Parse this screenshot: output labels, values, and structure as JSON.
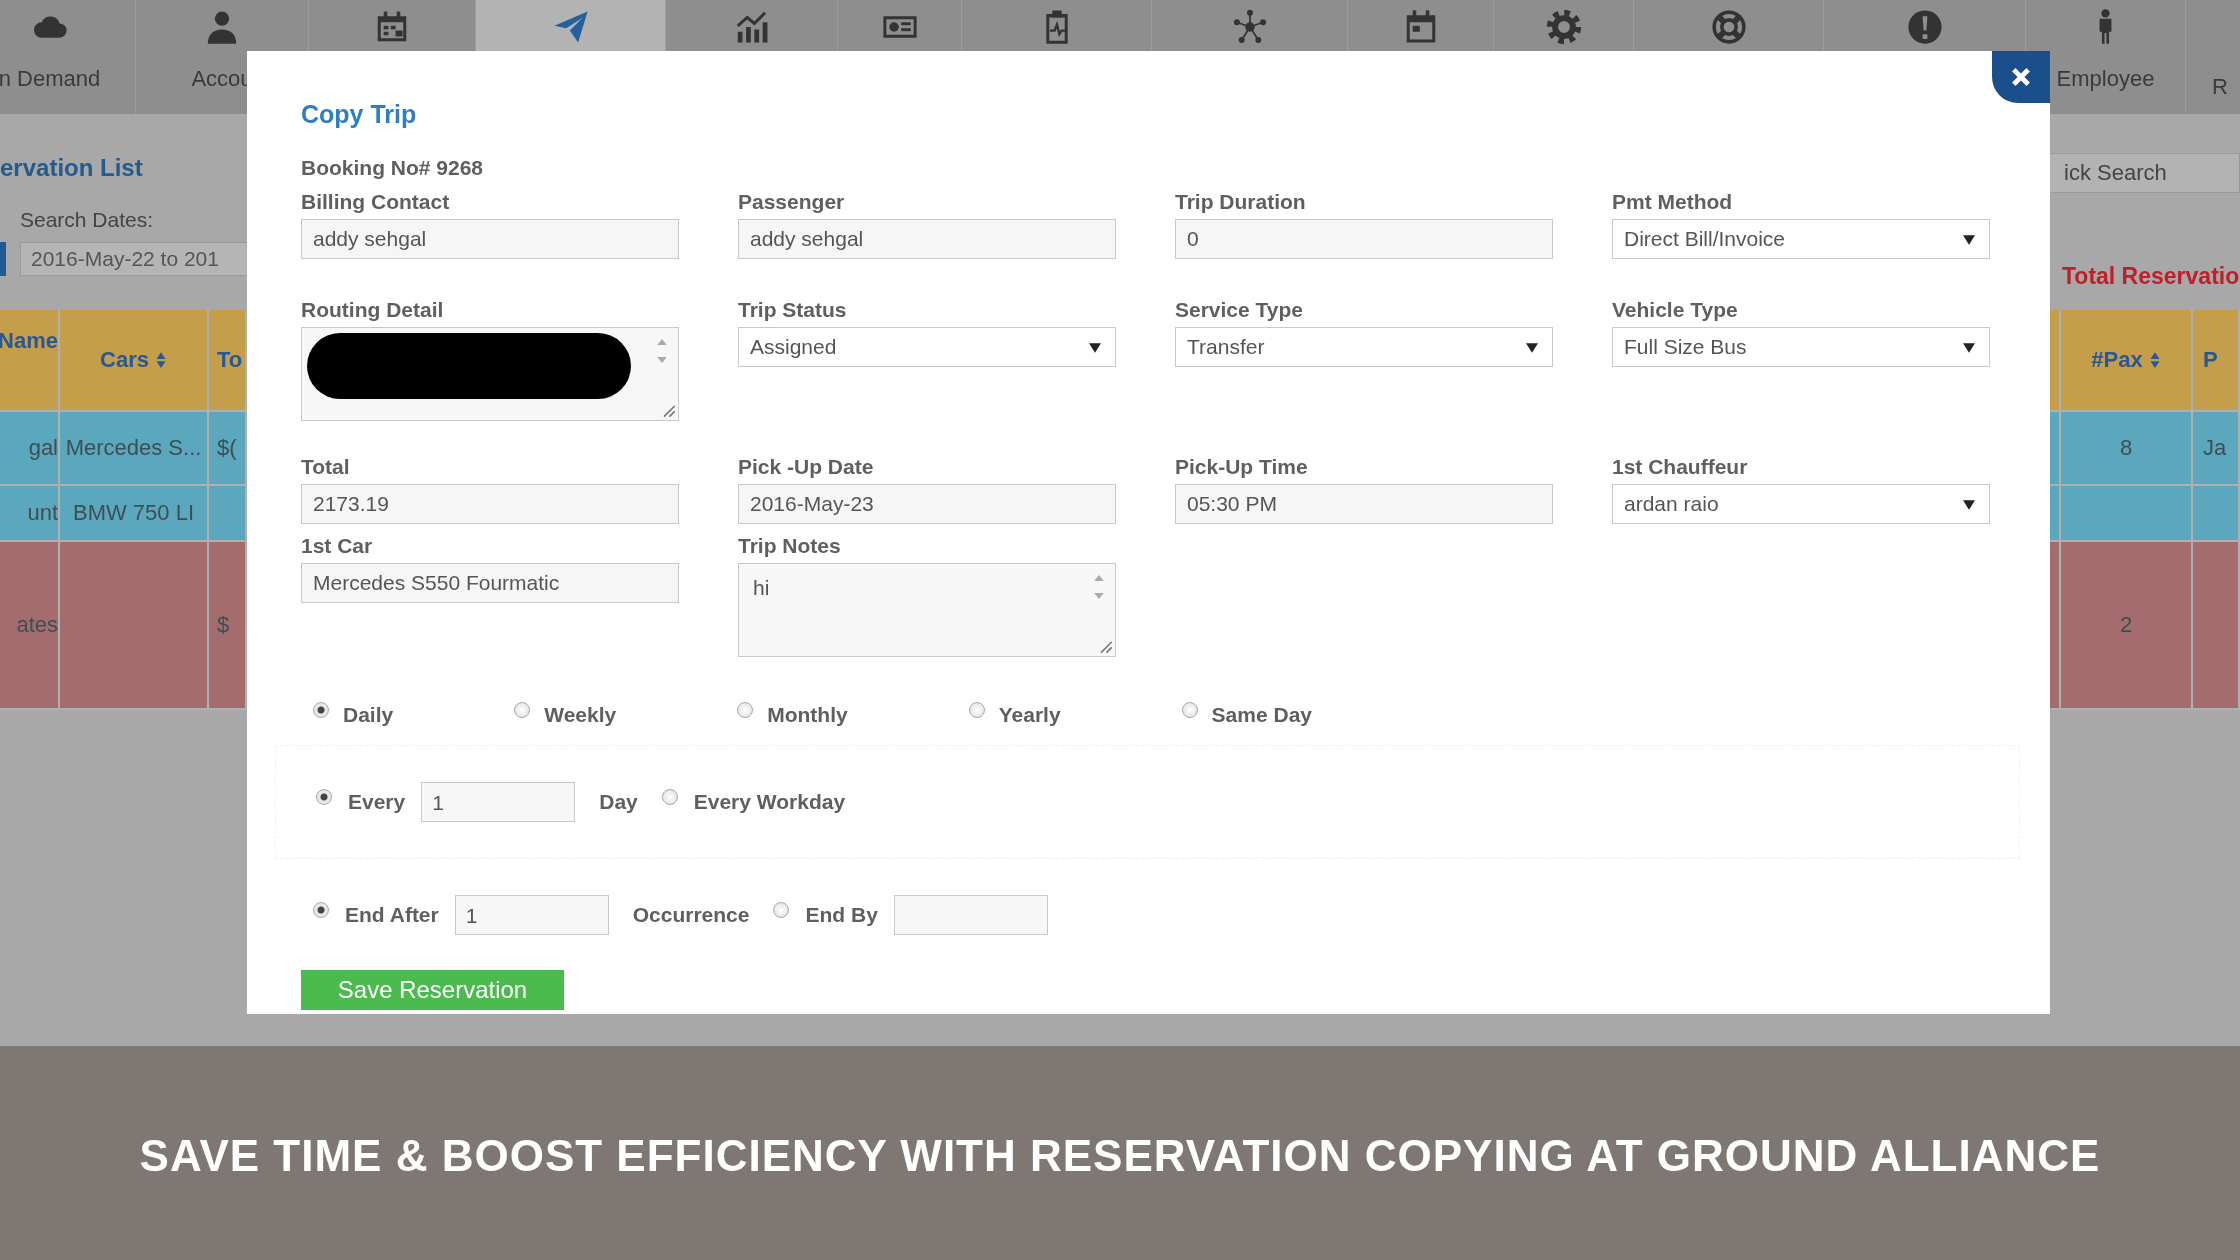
{
  "nav": [
    {
      "label": "n Demand",
      "selected": false
    },
    {
      "label": "Accou",
      "selected": false
    },
    {
      "selected": false
    },
    {
      "selected": true
    },
    {
      "selected": false
    },
    {
      "selected": false
    },
    {
      "selected": false
    },
    {
      "selected": false
    },
    {
      "selected": false
    },
    {
      "selected": false
    },
    {
      "selected": false
    },
    {
      "selected": false
    },
    {
      "label": "Employee",
      "selected": false
    },
    {
      "label": "R",
      "selected": false
    }
  ],
  "background": {
    "list_title": "ervation List",
    "search_label": "Search Dates:",
    "search_value": "2016-May-22 to 201",
    "quick_search_placeholder": "ick Search",
    "total_label": "Total Reservatio",
    "left_columns": [
      {
        "label": "Name",
        "sortable": false
      },
      {
        "label": "Cars",
        "sortable": true
      },
      {
        "label": "To"
      }
    ],
    "right_columns": [
      {
        "label": "#Pax",
        "sortable": true
      },
      {
        "label": "P"
      }
    ],
    "rows": [
      {
        "color": "#5ba8be",
        "left_cells": [
          "gal",
          "Mercedes S...",
          "$("
        ],
        "right_cells": [
          "8",
          "Ja"
        ]
      },
      {
        "color": "#5ba8be",
        "left_cells": [
          "unt",
          "BMW 750 LI",
          null
        ],
        "right_cells": [
          null,
          null
        ]
      },
      {
        "color": "#a46c6c",
        "left_cells": [
          "ates",
          null,
          "$"
        ],
        "right_cells": [
          "2",
          null
        ]
      }
    ]
  },
  "modal": {
    "title": "Copy Trip",
    "booking": "Booking No# 9268",
    "field_rows": [
      [
        {
          "label": "Billing Contact",
          "kind": "text",
          "value": "addy sehgal"
        },
        {
          "label": "Passenger",
          "kind": "text",
          "value": "addy sehgal"
        },
        {
          "label": "Trip Duration",
          "kind": "text",
          "value": "0"
        },
        {
          "label": "Pmt Method",
          "kind": "select",
          "value": "Direct Bill/Invoice"
        }
      ],
      [
        {
          "label": "Routing Detail",
          "kind": "textarea",
          "redacted": true
        },
        {
          "label": "Trip Status",
          "kind": "select",
          "value": "Assigned"
        },
        {
          "label": "Service Type",
          "kind": "select",
          "value": "Transfer"
        },
        {
          "label": "Vehicle Type",
          "kind": "select",
          "value": "Full Size Bus"
        }
      ],
      [
        {
          "label": "Total",
          "kind": "text",
          "value": "2173.19"
        },
        {
          "label": "Pick -Up Date",
          "kind": "text",
          "value": "2016-May-23"
        },
        {
          "label": "Pick-Up Time",
          "kind": "text",
          "value": "05:30 PM"
        },
        {
          "label": "1st Chauffeur",
          "kind": "select",
          "value": "ardan raio"
        }
      ],
      [
        {
          "label": "1st Car",
          "kind": "text",
          "value": "Mercedes S550 Fourmatic"
        },
        {
          "label": "Trip Notes",
          "kind": "textarea",
          "value": "hi"
        }
      ]
    ],
    "frequency": [
      {
        "label": "Daily",
        "selected": true
      },
      {
        "label": "Weekly",
        "selected": false
      },
      {
        "label": "Monthly",
        "selected": false
      },
      {
        "label": "Yearly",
        "selected": false
      },
      {
        "label": "Same Day",
        "selected": false
      }
    ],
    "repeat": [
      {
        "kind": "count",
        "label": "Every",
        "selected": true,
        "value": "1",
        "unit": "Day"
      },
      {
        "kind": "plain",
        "label": "Every Workday",
        "selected": false
      }
    ],
    "end": [
      {
        "kind": "count",
        "label": "End After",
        "selected": true,
        "value": "1",
        "unit": "Occurrence"
      },
      {
        "kind": "input",
        "label": "End By",
        "selected": false
      }
    ],
    "save_button": "Save Reservation"
  },
  "banner": "SAVE TIME & BOOST EFFICIENCY WITH RESERVATION COPYING AT GROUND ALLIANCE"
}
